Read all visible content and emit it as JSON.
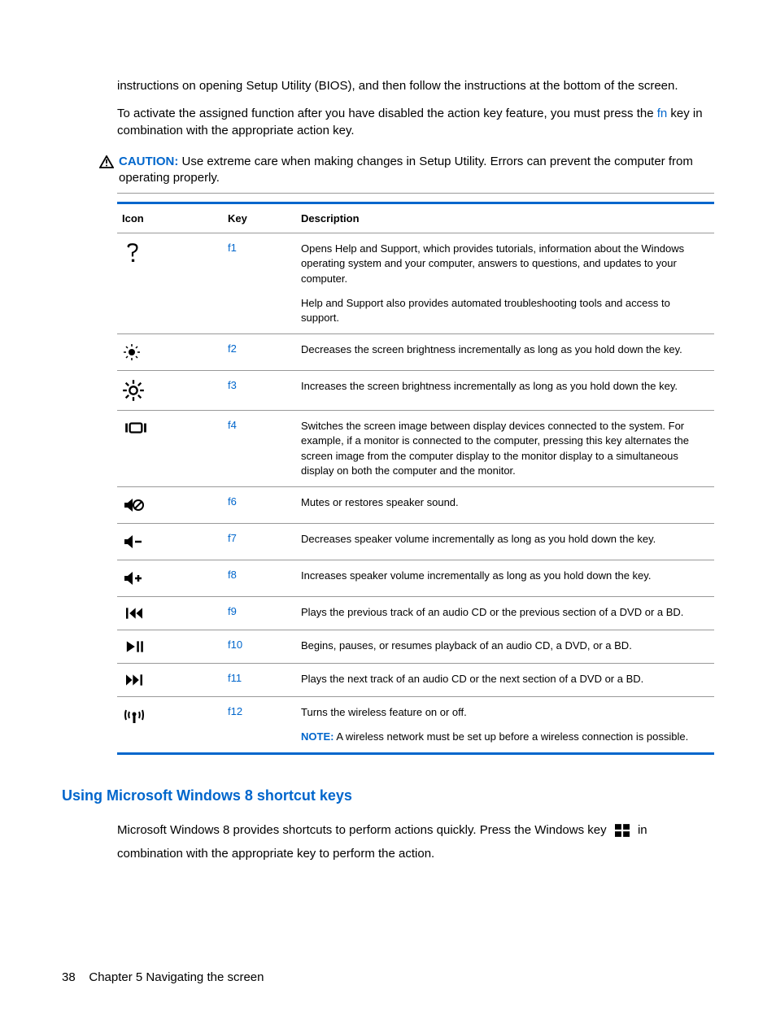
{
  "intro": {
    "p1": "instructions on opening Setup Utility (BIOS), and then follow the instructions at the bottom of the screen.",
    "p2a": "To activate the assigned function after you have disabled the action key feature, you must press the ",
    "fn": "fn",
    "p2b": " key in combination with the appropriate action key."
  },
  "caution": {
    "label": "CAUTION:",
    "text": "Use extreme care when making changes in Setup Utility. Errors can prevent the computer from operating properly."
  },
  "table": {
    "headers": {
      "icon": "Icon",
      "key": "Key",
      "desc": "Description"
    },
    "rows": [
      {
        "icon": "help-icon",
        "key": "f1",
        "desc": [
          "Opens Help and Support, which provides tutorials, information about the Windows operating system and your computer, answers to questions, and updates to your computer.",
          "Help and Support also provides automated troubleshooting tools and access to support."
        ]
      },
      {
        "icon": "brightness-down-icon",
        "key": "f2",
        "desc": [
          "Decreases the screen brightness incrementally as long as you hold down the key."
        ]
      },
      {
        "icon": "brightness-up-icon",
        "key": "f3",
        "desc": [
          "Increases the screen brightness incrementally as long as you hold down the key."
        ]
      },
      {
        "icon": "switch-display-icon",
        "key": "f4",
        "desc": [
          "Switches the screen image between display devices connected to the system. For example, if a monitor is connected to the computer, pressing this key alternates the screen image from the computer display to the monitor display to a simultaneous display on both the computer and the monitor."
        ]
      },
      {
        "icon": "mute-icon",
        "key": "f6",
        "desc": [
          "Mutes or restores speaker sound."
        ]
      },
      {
        "icon": "volume-down-icon",
        "key": "f7",
        "desc": [
          "Decreases speaker volume incrementally as long as you hold down the key."
        ]
      },
      {
        "icon": "volume-up-icon",
        "key": "f8",
        "desc": [
          "Increases speaker volume incrementally as long as you hold down the key."
        ]
      },
      {
        "icon": "previous-track-icon",
        "key": "f9",
        "desc": [
          "Plays the previous track of an audio CD or the previous section of a DVD or a BD."
        ]
      },
      {
        "icon": "play-pause-icon",
        "key": "f10",
        "desc": [
          "Begins, pauses, or resumes playback of an audio CD, a DVD, or a BD."
        ]
      },
      {
        "icon": "next-track-icon",
        "key": "f11",
        "desc": [
          "Plays the next track of an audio CD or the next section of a DVD or a BD."
        ]
      },
      {
        "icon": "wireless-icon",
        "key": "f12",
        "desc": [
          "Turns the wireless feature on or off."
        ],
        "note_label": "NOTE:",
        "note": "A wireless network must be set up before a wireless connection is possible."
      }
    ]
  },
  "section2": {
    "heading": "Using Microsoft Windows 8 shortcut keys",
    "p1a": "Microsoft Windows 8 provides shortcuts to perform actions quickly. Press the Windows key",
    "p1b": "in combination with the appropriate key to perform the action."
  },
  "footer": {
    "page": "38",
    "chapter": "Chapter 5   Navigating the screen"
  }
}
